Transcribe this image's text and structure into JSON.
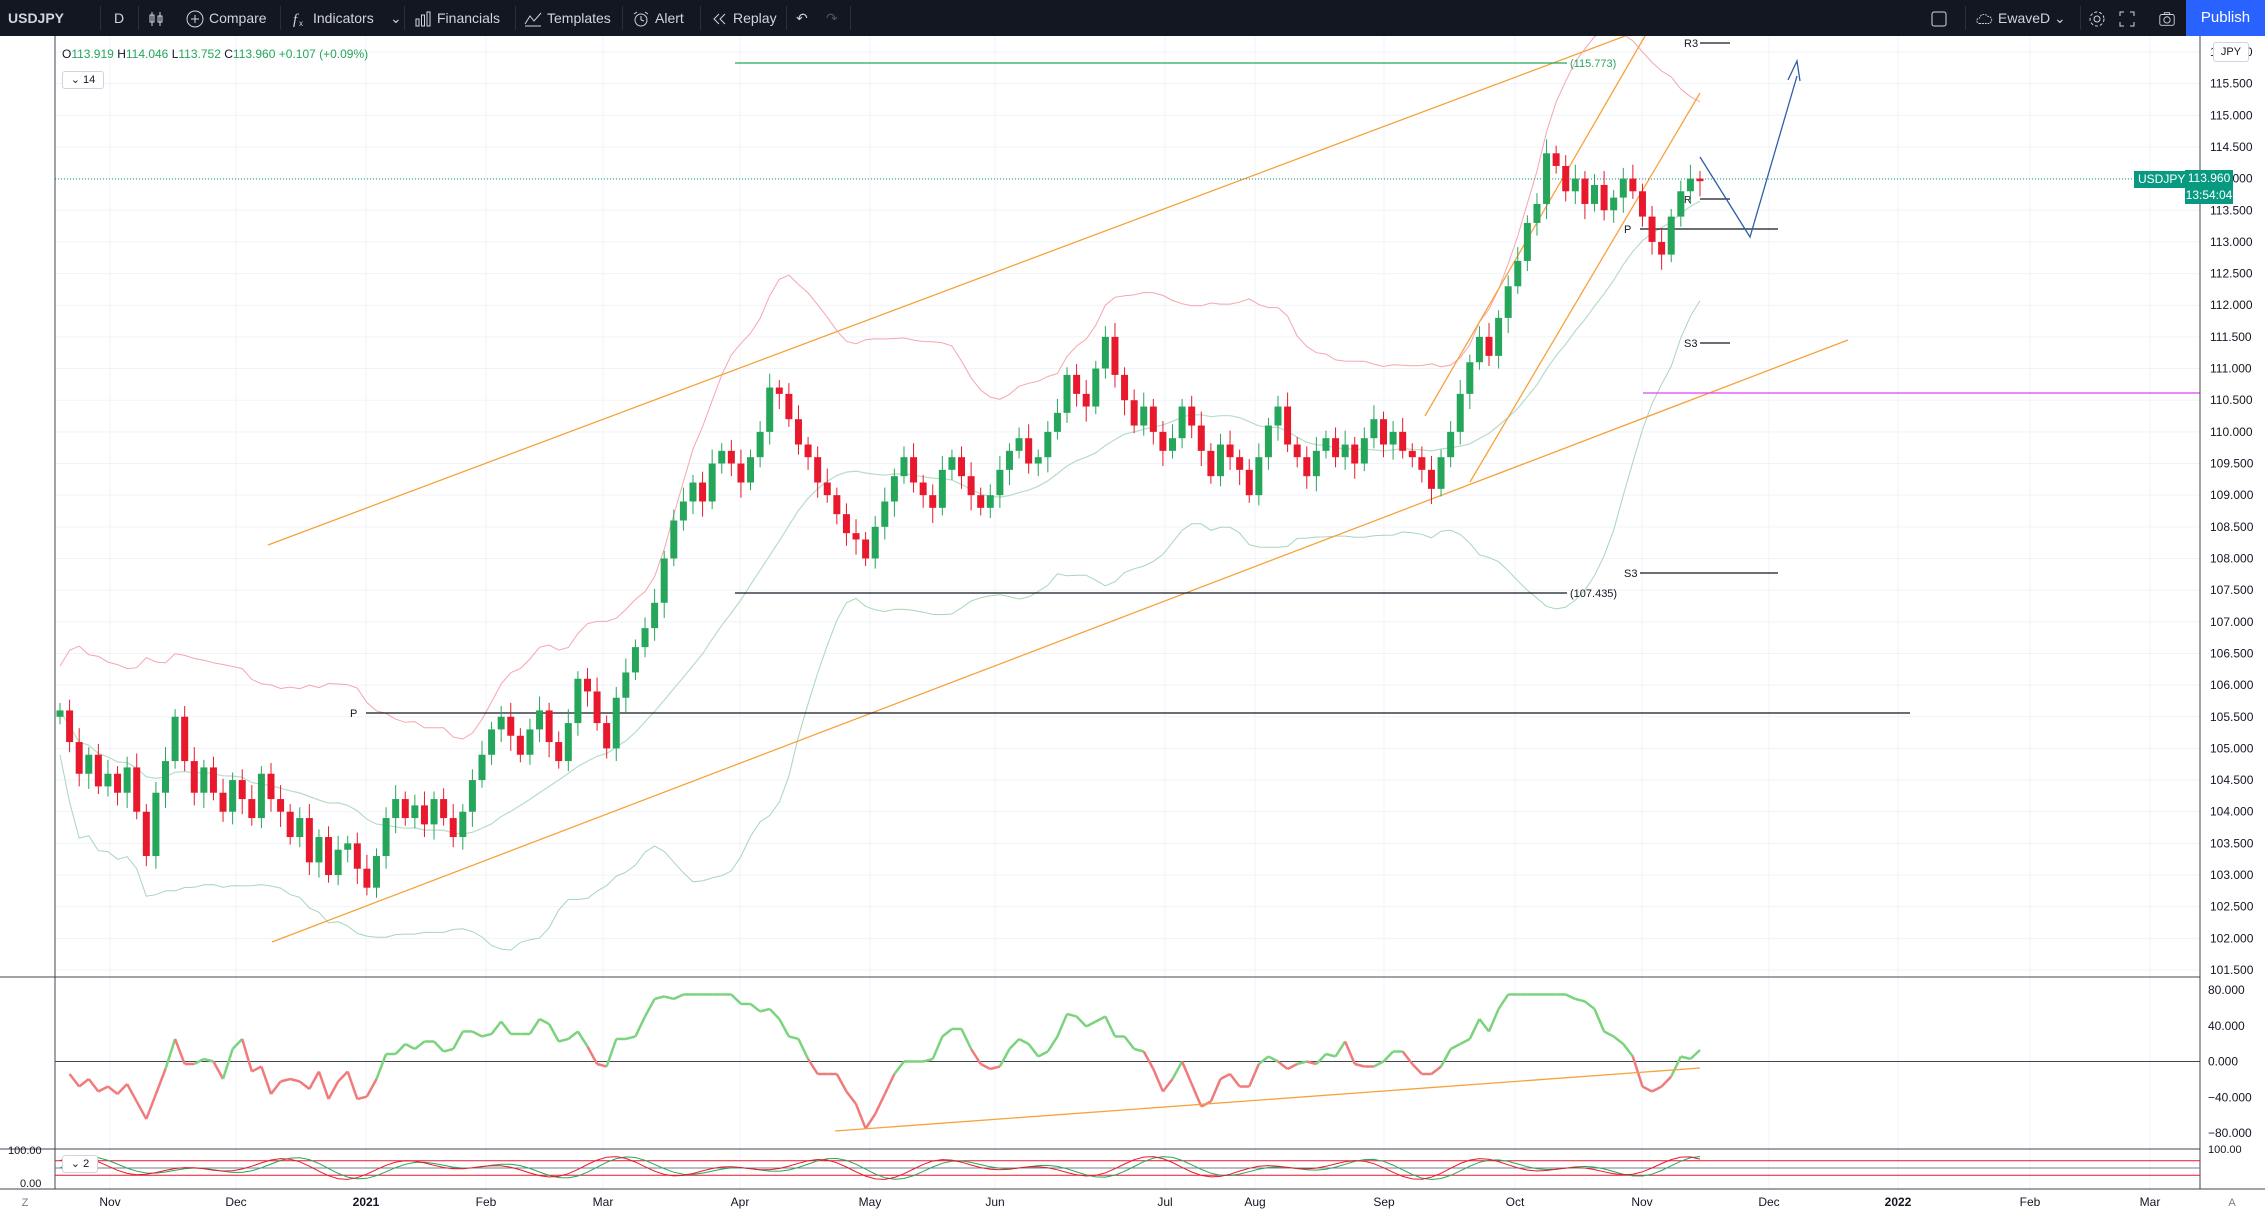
{
  "toolbar": {
    "symbol": "USDJPY",
    "interval": "D",
    "compare": "Compare",
    "indicators": "Indicators",
    "financials": "Financials",
    "templates": "Templates",
    "alert": "Alert",
    "replay": "Replay",
    "layout_name": "EwaveD",
    "publish": "Publish"
  },
  "legend": {
    "o_label": "O",
    "o": "113.919",
    "h_label": "H",
    "h": "114.046",
    "l_label": "L",
    "l": "113.752",
    "c_label": "C",
    "c": "113.960",
    "change": "+0.107 (+0.09%)",
    "rsi_length": "14",
    "stoch_length": "2"
  },
  "price_scale": {
    "currency": "JPY",
    "ticks": [
      "116.000",
      "115.500",
      "115.000",
      "114.500",
      "114.000",
      "113.500",
      "113.000",
      "112.500",
      "112.000",
      "111.500",
      "111.000",
      "110.500",
      "110.000",
      "109.500",
      "109.000",
      "108.500",
      "108.000",
      "107.500",
      "107.000",
      "106.500",
      "106.000",
      "105.500",
      "105.000",
      "104.500",
      "104.000",
      "103.500",
      "103.000",
      "102.500",
      "102.000",
      "101.500"
    ],
    "last_symbol": "USDJPY",
    "last_price": "113.960",
    "countdown": "13:54:04"
  },
  "rsi_scale": {
    "ticks": [
      "80.000",
      "40.000",
      "0.000",
      "−40.000",
      "−80.000"
    ]
  },
  "stoch_scale": {
    "ticks": [
      "100.00",
      "0.00",
      "100.00"
    ]
  },
  "time_axis": {
    "labels": [
      "Nov",
      "Dec",
      "2021",
      "Feb",
      "Mar",
      "Apr",
      "May",
      "Jun",
      "Jul",
      "Aug",
      "Sep",
      "Oct",
      "Nov",
      "Dec",
      "2022",
      "Feb",
      "Mar"
    ],
    "left_button": "Z",
    "right_button": "A"
  },
  "annotations": {
    "high_level": "(115.773)",
    "low_level": "(107.435)",
    "pivot_p": "P",
    "r3": "R3",
    "s3_upper": "S3",
    "s3_lower": "S3",
    "p_small": "P",
    "r_small": "R"
  },
  "colors": {
    "toolbar_bg": "#131722",
    "up_candle": "#26a65b",
    "down_candle": "#e8192c",
    "channel": "#f7a23b",
    "publish": "#2962ff",
    "last_price": "#089981",
    "projection": "#2f5ea8",
    "magenta_level": "#e040fb"
  },
  "chart_data": {
    "type": "candlestick",
    "symbol": "USDJPY",
    "timeframe": "D",
    "y_range": [
      101.5,
      116.0
    ],
    "last_close": 113.96,
    "levels": {
      "high": 115.773,
      "low": 107.435
    },
    "rsi_range": [
      -80,
      80
    ],
    "stoch_range": [
      0,
      100
    ],
    "closes": [
      105.6,
      105.1,
      104.6,
      104.9,
      104.4,
      104.6,
      104.3,
      104.7,
      104.0,
      103.3,
      104.3,
      104.8,
      105.5,
      104.8,
      104.3,
      104.7,
      104.3,
      104.0,
      104.5,
      104.2,
      103.9,
      104.6,
      104.2,
      104.0,
      103.6,
      103.9,
      103.2,
      103.6,
      103.0,
      103.4,
      103.5,
      103.1,
      102.8,
      103.3,
      103.9,
      104.2,
      103.9,
      104.1,
      103.8,
      104.2,
      103.9,
      103.6,
      104.0,
      104.5,
      104.9,
      105.3,
      105.5,
      105.2,
      104.9,
      105.3,
      105.6,
      105.1,
      104.8,
      105.4,
      106.1,
      105.9,
      105.4,
      105.0,
      105.8,
      106.2,
      106.6,
      106.9,
      107.3,
      108.0,
      108.6,
      108.9,
      109.2,
      108.9,
      109.5,
      109.7,
      109.5,
      109.2,
      109.6,
      110.0,
      110.7,
      110.6,
      110.2,
      109.8,
      109.6,
      109.2,
      109.0,
      108.7,
      108.4,
      108.3,
      108.0,
      108.5,
      108.9,
      109.3,
      109.6,
      109.2,
      109.0,
      108.8,
      109.4,
      109.6,
      109.3,
      109.0,
      108.8,
      109.0,
      109.4,
      109.7,
      109.9,
      109.5,
      109.6,
      110.0,
      110.3,
      110.9,
      110.6,
      110.4,
      111.0,
      111.5,
      110.9,
      110.5,
      110.1,
      110.4,
      110.0,
      109.7,
      109.9,
      110.4,
      110.1,
      109.7,
      109.3,
      109.8,
      109.6,
      109.4,
      109.0,
      109.6,
      110.1,
      110.4,
      109.8,
      109.6,
      109.3,
      109.7,
      109.9,
      109.6,
      109.8,
      109.5,
      109.9,
      110.2,
      109.8,
      110.0,
      109.7,
      109.6,
      109.4,
      109.1,
      109.6,
      110.0,
      110.6,
      111.1,
      111.5,
      111.2,
      111.8,
      112.3,
      112.7,
      113.3,
      113.6,
      114.4,
      114.2,
      113.8,
      114.0,
      113.6,
      113.9,
      113.5,
      113.7,
      114.0,
      113.8,
      113.4,
      113.0,
      112.8,
      113.4,
      113.8,
      114.0,
      113.96
    ]
  }
}
